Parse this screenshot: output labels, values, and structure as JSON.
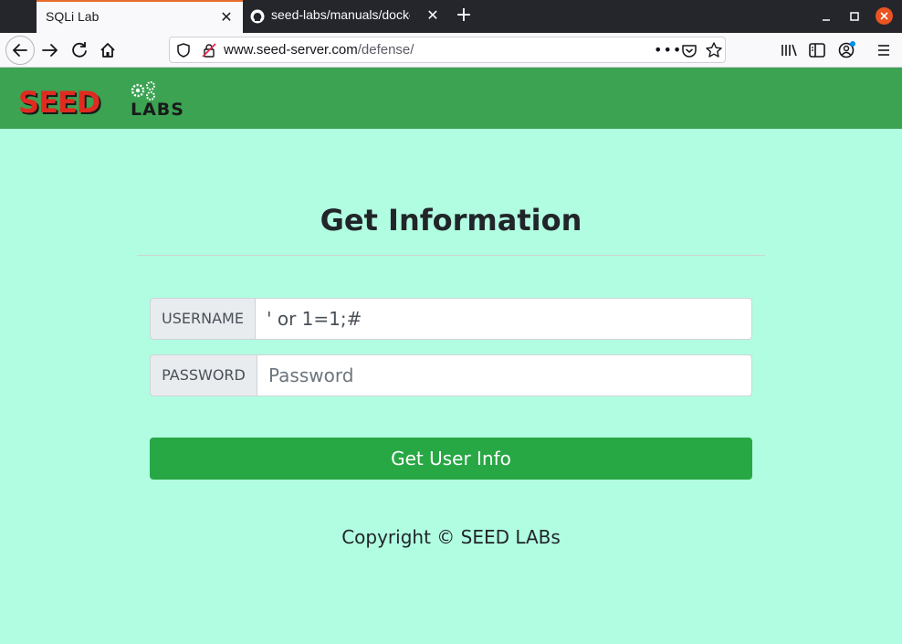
{
  "browser": {
    "tabs": [
      {
        "title": "SQLi Lab",
        "active": true
      },
      {
        "title": "seed-labs/manuals/docker",
        "active": false
      }
    ],
    "url": {
      "host": "www.seed-server.com",
      "path": "/defense/"
    }
  },
  "header": {
    "logo_text_main": "SEED",
    "logo_text_sub": "LABS"
  },
  "form": {
    "title": "Get Information",
    "username_label": "USERNAME",
    "username_value": "' or 1=1;#",
    "password_label": "PASSWORD",
    "password_placeholder": "Password",
    "submit_label": "Get User Info"
  },
  "footer": {
    "copyright": "Copyright © SEED LABs"
  },
  "colors": {
    "header_green": "#3ba352",
    "page_bg": "#b1fde1",
    "button_green": "#28a745",
    "logo_red": "#e02b20"
  }
}
